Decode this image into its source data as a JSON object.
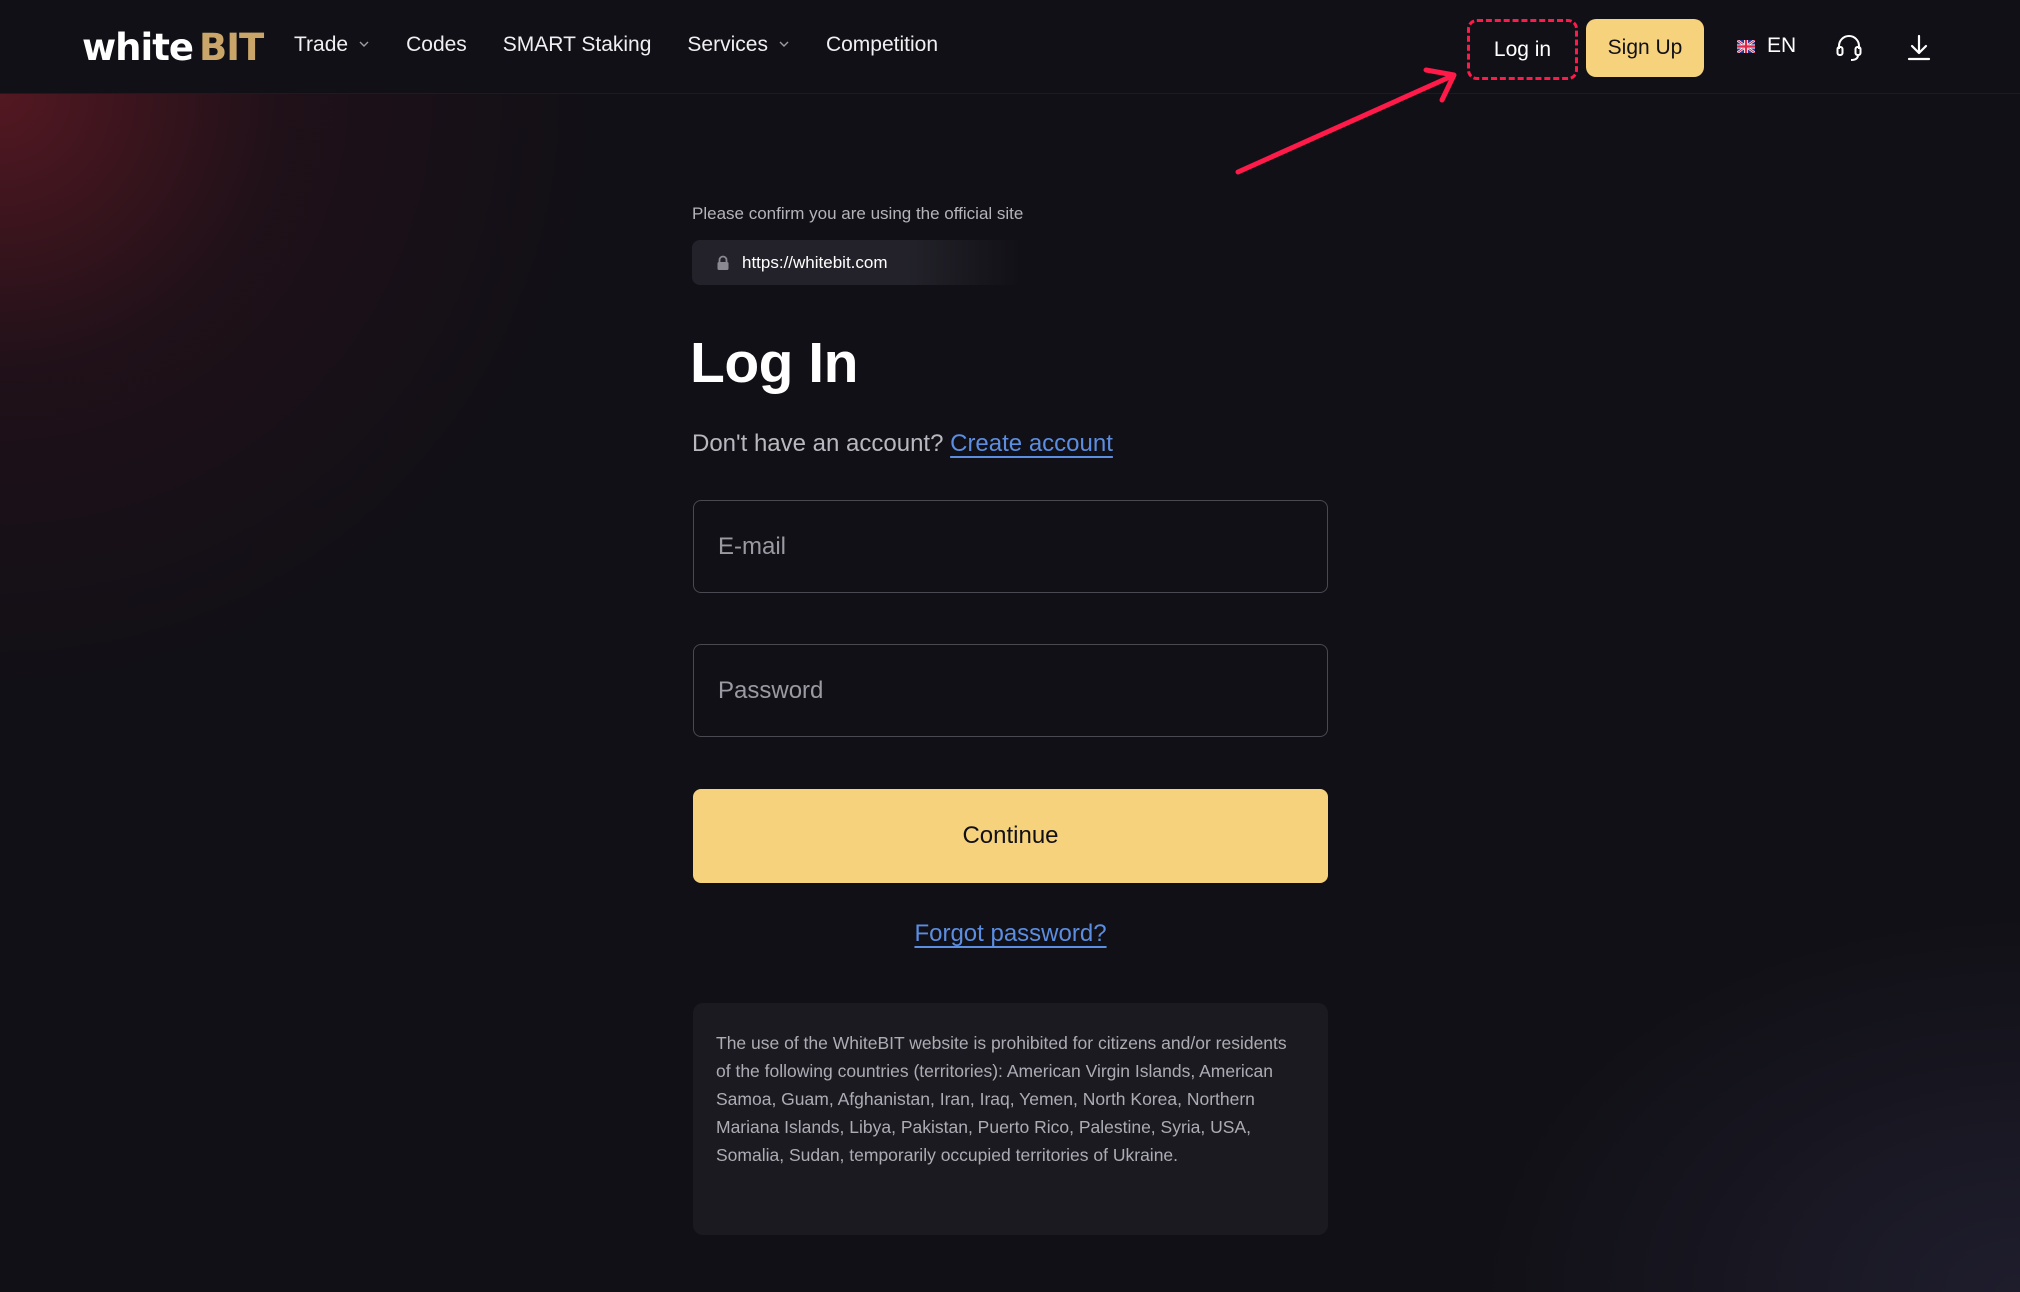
{
  "header": {
    "logo_white": "white",
    "logo_bit": "BIT",
    "nav": [
      {
        "label": "Trade",
        "has_dropdown": true
      },
      {
        "label": "Codes",
        "has_dropdown": false
      },
      {
        "label": "SMART Staking",
        "has_dropdown": false
      },
      {
        "label": "Services",
        "has_dropdown": true
      },
      {
        "label": "Competition",
        "has_dropdown": false
      }
    ],
    "login_label": "Log in",
    "signup_label": "Sign Up",
    "language": "EN",
    "icons": {
      "support": "headset-icon",
      "download": "download-icon",
      "flag": "uk-flag-icon"
    }
  },
  "login": {
    "confirm_text": "Please confirm you are using the official site",
    "official_url": "https://whitebit.com",
    "title": "Log In",
    "no_account_text": "Don't have an account?",
    "create_account_link": "Create account",
    "email_placeholder": "E-mail",
    "password_placeholder": "Password",
    "continue_label": "Continue",
    "forgot_password_link": "Forgot password?",
    "restriction_notice": "The use of the WhiteBIT website is prohibited for citizens and/or residents of the following countries (territories): American Virgin Islands, American Samoa, Guam, Afghanistan, Iran, Iraq, Yemen, North Korea, Northern Mariana Islands, Libya, Pakistan, Puerto Rico, Palestine, Syria, USA, Somalia, Sudan, temporarily occupied territories of Ukraine."
  },
  "colors": {
    "background": "#111016",
    "accent_yellow": "#f7d27c",
    "link_blue": "#5b8de0",
    "annotation_red": "#ff1a4a"
  }
}
